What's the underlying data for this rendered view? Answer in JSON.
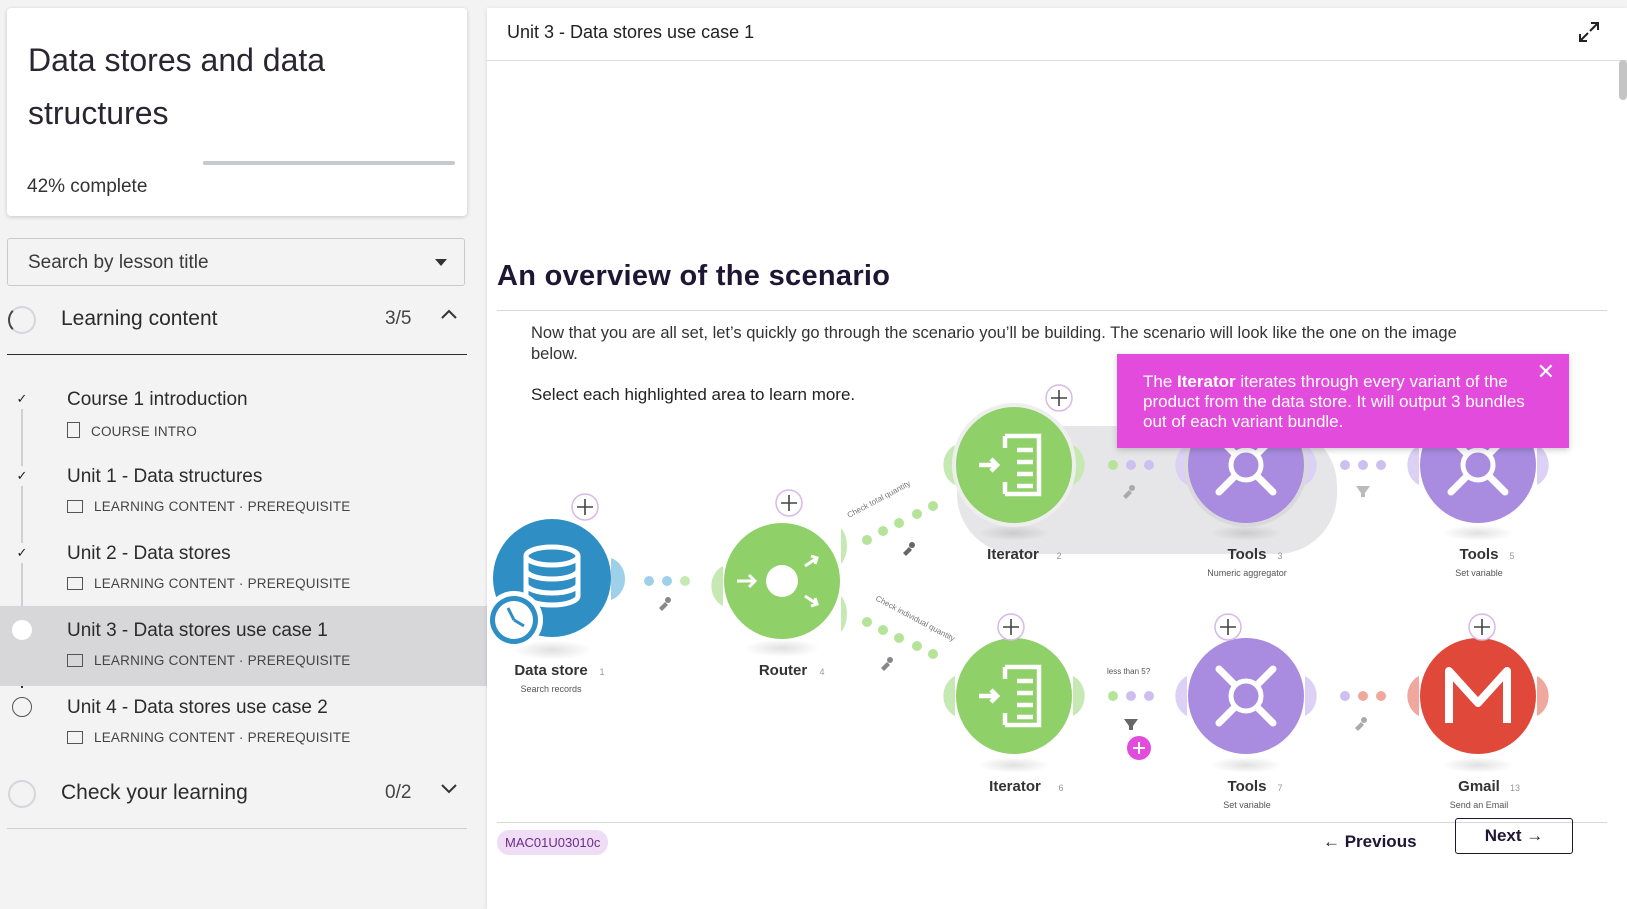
{
  "course": {
    "title": "Data stores and data structures",
    "progress_value": "42%",
    "progress_suffix": " complete",
    "progress_fraction": 0.42
  },
  "search": {
    "placeholder": "Search by lesson title"
  },
  "sections": [
    {
      "label": "Learning content",
      "count": "3/5",
      "lessons": [
        {
          "title": "Course 1 introduction",
          "meta": "COURSE INTRO",
          "status": "done"
        },
        {
          "title": "Unit 1 - Data structures",
          "meta": "LEARNING CONTENT · PREREQUISITE",
          "status": "done"
        },
        {
          "title": "Unit 2 - Data stores",
          "meta": "LEARNING CONTENT · PREREQUISITE",
          "status": "done"
        },
        {
          "title": "Unit 3 - Data stores use case 1",
          "meta": "LEARNING CONTENT · PREREQUISITE",
          "status": "current"
        },
        {
          "title": "Unit 4 - Data stores use case 2",
          "meta": "LEARNING CONTENT · PREREQUISITE",
          "status": "open"
        }
      ]
    },
    {
      "label": "Check your learning",
      "count": "0/2"
    }
  ],
  "main": {
    "breadcrumb": "Unit 3 - Data stores use case 1",
    "section_title": "An overview of the scenario",
    "intro": "Now that you are all set, let’s quickly go through the scenario you’ll be building. The scenario will look like the one on the image below.",
    "instruction": "Select each highlighted area to learn more.",
    "tooltip": {
      "prefix": "The ",
      "bold": "Iterator",
      "suffix": " iterates through every variant of the product from the data store. It will output 3 bundles out of each variant bundle."
    },
    "code": "MAC01U03010c",
    "prev_label": "← Previous",
    "next_label": "Next →"
  },
  "diagram": {
    "modules": [
      {
        "name": "Data store",
        "num": "1",
        "sub": "Search records",
        "color": "#2f8fc4"
      },
      {
        "name": "Router",
        "num": "4",
        "sub": "",
        "color": "#8fd068"
      },
      {
        "name": "Iterator",
        "num": "2",
        "sub": "",
        "color": "#8fd068"
      },
      {
        "name": "Tools",
        "num": "3",
        "sub": "Numeric aggregator",
        "color": "#a98be0"
      },
      {
        "name": "Tools",
        "num": "5",
        "sub": "Set variable",
        "color": "#a98be0"
      },
      {
        "name": "Iterator",
        "num": "6",
        "sub": "",
        "color": "#8fd068"
      },
      {
        "name": "Tools",
        "num": "7",
        "sub": "Set variable",
        "color": "#a98be0"
      },
      {
        "name": "Gmail",
        "num": "13",
        "sub": "Send an Email",
        "color": "#e0493a"
      }
    ],
    "route_labels": [
      "Check total quantity",
      "Check individual quantity"
    ],
    "filter_label": "less than 5?"
  },
  "icons": [
    "check-icon",
    "chevron-up-icon",
    "chevron-down-icon",
    "expand-icon",
    "close-icon",
    "caret-down-icon",
    "plus-icon",
    "wrench-icon",
    "filter-icon",
    "clock-icon"
  ]
}
